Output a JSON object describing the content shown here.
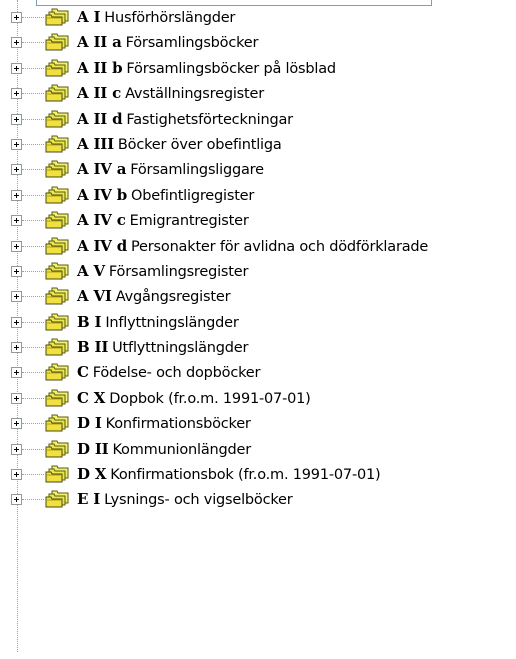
{
  "tree": {
    "items": [
      {
        "code": "A I",
        "label": "Husförhörslängder",
        "icon": "folder-stack-icon"
      },
      {
        "code": "A II a",
        "label": "Församlingsböcker",
        "icon": "folder-stack-icon"
      },
      {
        "code": "A II b",
        "label": "Församlingsböcker på lösblad",
        "icon": "folder-stack-icon"
      },
      {
        "code": "A II c",
        "label": "Avställningsregister",
        "icon": "folder-stack-icon"
      },
      {
        "code": "A II d",
        "label": "Fastighetsförteckningar",
        "icon": "folder-stack-icon"
      },
      {
        "code": "A III",
        "label": "Böcker över obefintliga",
        "icon": "folder-stack-icon"
      },
      {
        "code": "A IV a",
        "label": "Församlingsliggare",
        "icon": "folder-stack-icon"
      },
      {
        "code": "A IV b",
        "label": "Obefintligregister",
        "icon": "folder-stack-icon"
      },
      {
        "code": "A IV c",
        "label": "Emigrantregister",
        "icon": "folder-stack-icon"
      },
      {
        "code": "A IV d",
        "label": "Personakter för avlidna och dödförklarade",
        "icon": "folder-stack-icon"
      },
      {
        "code": "A V",
        "label": "Församlingsregister",
        "icon": "folder-stack-icon"
      },
      {
        "code": "A VI",
        "label": "Avgångsregister",
        "icon": "folder-stack-icon"
      },
      {
        "code": "B I",
        "label": "Inflyttningslängder",
        "icon": "folder-stack-icon"
      },
      {
        "code": "B II",
        "label": "Utflyttningslängder",
        "icon": "folder-stack-icon"
      },
      {
        "code": "C",
        "label": "Födelse- och dopböcker",
        "icon": "folder-stack-icon"
      },
      {
        "code": "C X",
        "label": "Dopbok (fr.o.m. 1991-07-01)",
        "icon": "folder-stack-icon"
      },
      {
        "code": "D I",
        "label": "Konfirmationsböcker",
        "icon": "folder-stack-icon"
      },
      {
        "code": "D II",
        "label": "Kommunionlängder",
        "icon": "folder-stack-icon"
      },
      {
        "code": "D X",
        "label": "Konfirmationsbok (fr.o.m. 1991-07-01)",
        "icon": "folder-stack-icon"
      },
      {
        "code": "E I",
        "label": "Lysnings- och vigselböcker",
        "icon": "folder-stack-icon"
      }
    ],
    "colors": {
      "folder": "#e8e84a",
      "folder_dark": "#b0a020",
      "outline": "#4a4a10"
    }
  }
}
